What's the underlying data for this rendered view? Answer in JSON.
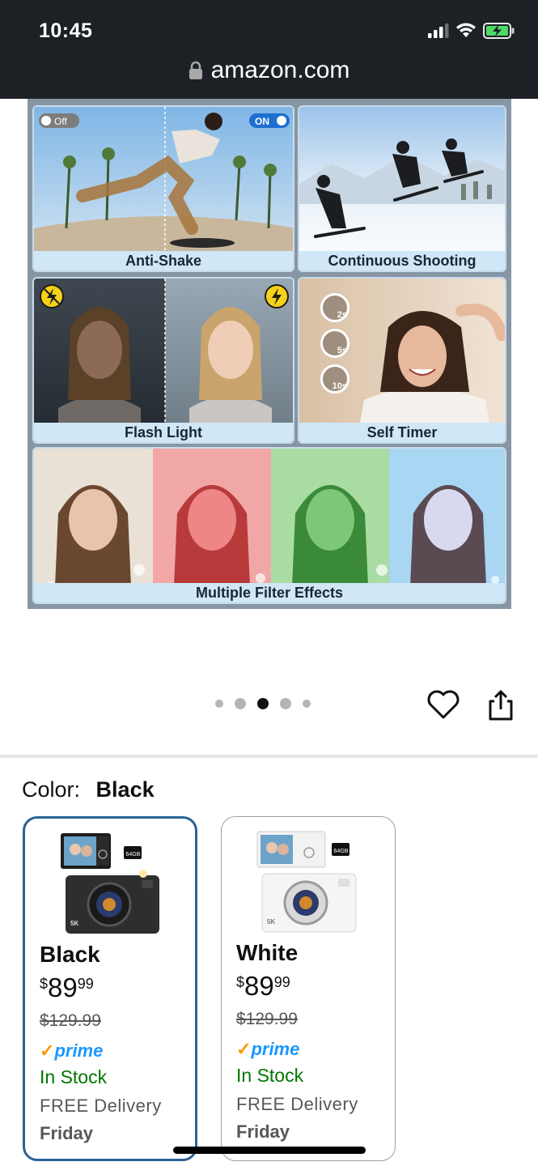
{
  "status_bar": {
    "time": "10:45"
  },
  "url_bar": {
    "domain": "amazon.com"
  },
  "gallery": {
    "tiles": [
      {
        "caption": "Anti-Shake",
        "toggle_off": "Off",
        "toggle_on": "ON"
      },
      {
        "caption": "Continuous Shooting"
      },
      {
        "caption": "Flash Light"
      },
      {
        "caption": "Self Timer",
        "timers": [
          "2s",
          "5s",
          "10s"
        ]
      },
      {
        "caption": "Multiple Filter Effects"
      }
    ],
    "dots_total": 5,
    "dots_active_index": 2
  },
  "color_selector": {
    "label": "Color:",
    "selected_value": "Black",
    "options": [
      {
        "name": "Black",
        "price_currency": "$",
        "price_whole": "89",
        "price_fraction": "99",
        "list_price": "$129.99",
        "prime": "prime",
        "availability": "In Stock",
        "delivery": "FREE Delivery",
        "delivery_day": "Friday",
        "selected": true,
        "thumb_labels": {
          "card": "64GB",
          "badge": "5K"
        }
      },
      {
        "name": "White",
        "price_currency": "$",
        "price_whole": "89",
        "price_fraction": "99",
        "list_price": "$129.99",
        "prime": "prime",
        "availability": "In Stock",
        "delivery": "FREE Delivery",
        "delivery_day": "Friday",
        "selected": false,
        "thumb_labels": {
          "card": "64GB",
          "badge": "5K"
        }
      }
    ]
  },
  "colors": {
    "topbar_bg": "#1d2126",
    "selected_border": "#2a6296",
    "in_stock": "#007600",
    "prime_blue": "#1a98ff",
    "prime_check": "#ff9900"
  }
}
